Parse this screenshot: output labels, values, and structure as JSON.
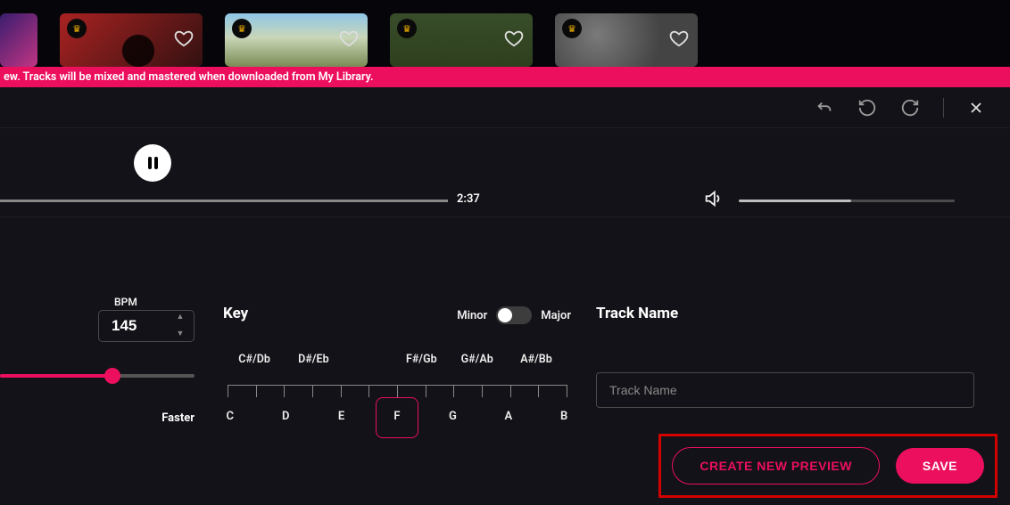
{
  "header": {
    "categories": [
      "",
      "",
      "",
      "",
      ""
    ]
  },
  "banner": {
    "text": "ew. Tracks will be mixed and mastered when downloaded from My Library."
  },
  "player": {
    "time": "2:37",
    "progress_percent": 100,
    "volume_percent": 52
  },
  "bpm": {
    "label": "BPM",
    "value": "145",
    "slider_percent": 58,
    "faster_label": "Faster"
  },
  "key": {
    "heading": "Key",
    "tonality": {
      "minor_label": "Minor",
      "major_label": "Major",
      "is_major": false
    },
    "top_keys": [
      "C#/Db",
      "D#/Eb",
      "F#/Gb",
      "G#/Ab",
      "A#/Bb"
    ],
    "bottom_keys": [
      "C",
      "D",
      "E",
      "F",
      "G",
      "A",
      "B"
    ],
    "selected": "F"
  },
  "trackname": {
    "heading": "Track Name",
    "placeholder": "Track Name",
    "value": ""
  },
  "actions": {
    "create_label": "CREATE NEW PREVIEW",
    "save_label": "SAVE"
  },
  "colors": {
    "accent": "#ec0f5d"
  }
}
